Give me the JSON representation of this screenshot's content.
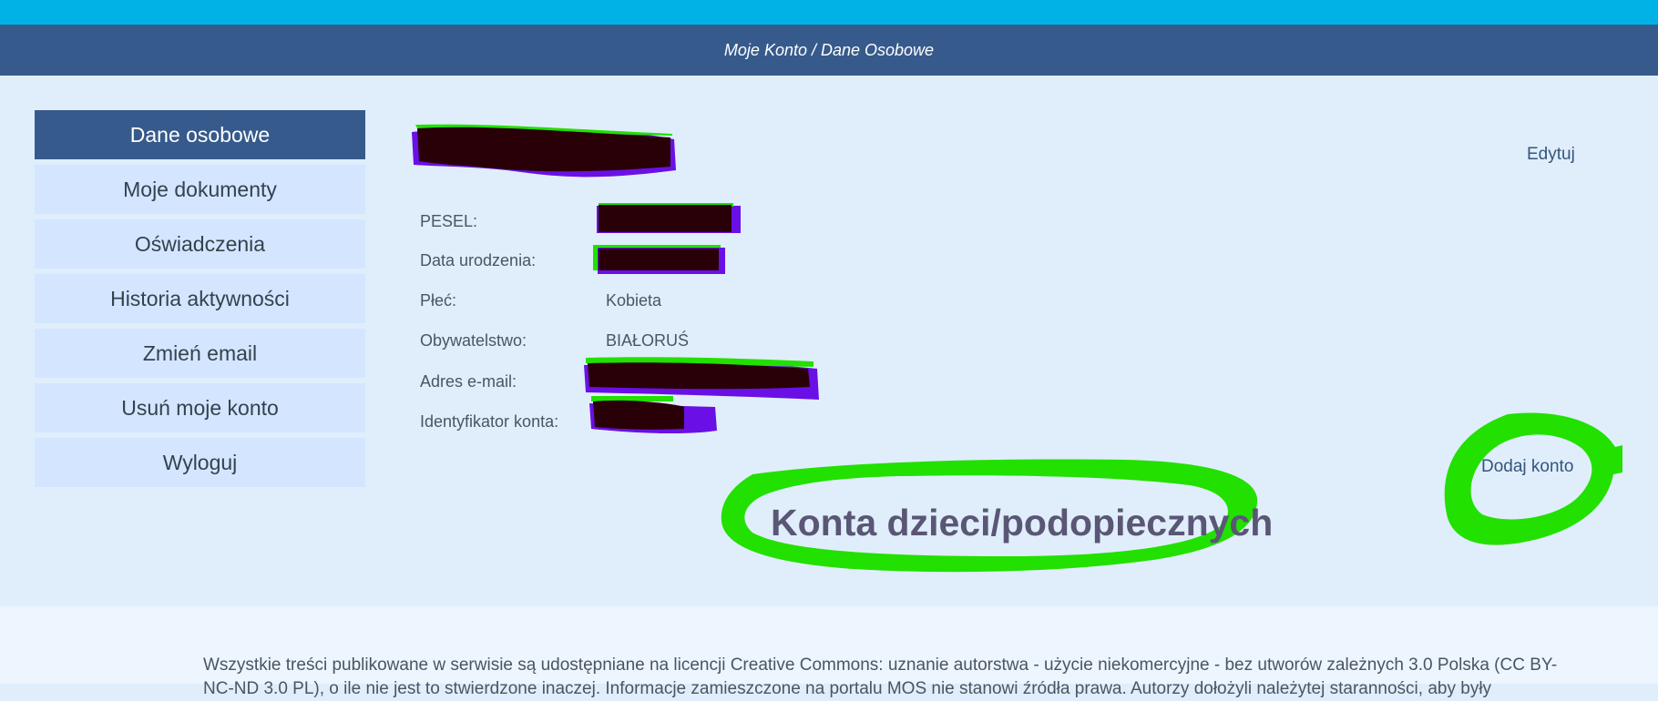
{
  "header": {
    "breadcrumb": "Moje Konto / Dane Osobowe"
  },
  "sidebar": {
    "items": [
      {
        "label": "Dane osobowe",
        "active": true
      },
      {
        "label": "Moje dokumenty"
      },
      {
        "label": "Oświadczenia"
      },
      {
        "label": "Historia aktywności"
      },
      {
        "label": "Zmień email"
      },
      {
        "label": "Usuń moje konto"
      },
      {
        "label": "Wyloguj"
      }
    ]
  },
  "profile": {
    "edit_label": "Edytuj",
    "fields": {
      "pesel_label": "PESEL:",
      "dob_label": "Data urodzenia:",
      "gender_label": "Płeć:",
      "gender_value": "Kobieta",
      "citizenship_label": "Obywatelstwo:",
      "citizenship_value": "BIAŁORUŚ",
      "email_label": "Adres e-mail:",
      "account_id_label": "Identyfikator konta:"
    }
  },
  "children": {
    "title": "Konta dzieci/podopiecznych",
    "add_label": "Dodaj konto"
  },
  "footer": {
    "text": "Wszystkie treści publikowane w serwisie są udostępniane na licencji Creative Commons: uznanie autorstwa - użycie niekomercyjne - bez utworów zależnych 3.0 Polska (CC BY-NC-ND 3.0 PL), o ile nie jest to stwierdzone inaczej. Informacje zamieszczone na portalu MOS nie stanowi źródła prawa. Autorzy dołożyli należytej staranności, aby były"
  },
  "colors": {
    "topbar": "#00b2e6",
    "header": "#365a8b",
    "content_bg": "#e0eefc",
    "nav_item": "#d4e6ff",
    "annotation_green": "#22e000",
    "annotation_purple": "#6a10e6",
    "redaction": "#2a0008"
  }
}
